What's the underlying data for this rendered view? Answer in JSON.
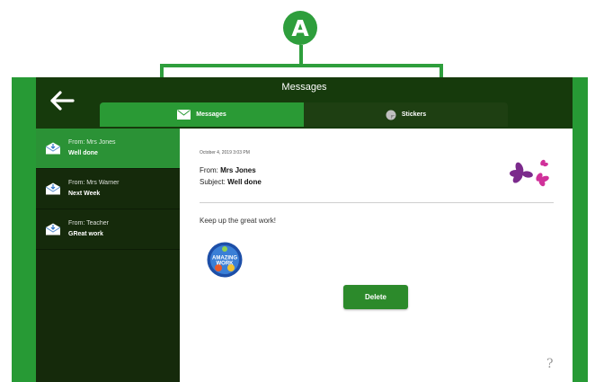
{
  "annotation": {
    "label": "A"
  },
  "header": {
    "title": "Messages"
  },
  "tabs": [
    {
      "label": "Messages",
      "icon": "envelope-icon",
      "selected": true
    },
    {
      "label": "Stickers",
      "icon": "sticker-icon",
      "selected": false
    }
  ],
  "messages": [
    {
      "from": "From: Mrs Jones",
      "subject": "Well done",
      "selected": true
    },
    {
      "from": "From: Mrs Warner",
      "subject": "Next Week",
      "selected": false
    },
    {
      "from": "From: Teacher",
      "subject": "GReat work",
      "selected": false
    }
  ],
  "detail": {
    "date": "October 4, 2019 3:03 PM",
    "from_label": "From:",
    "from_value": "Mrs Jones",
    "subject_label": "Subject:",
    "subject_value": "Well done",
    "body": "Keep up the great work!",
    "sticker_text": "AMAZING WORK",
    "delete_label": "Delete",
    "help_glyph": "?"
  },
  "colors": {
    "accent_green": "#2e9e3c",
    "header_dark": "#163a0c",
    "sidebar_dark": "#152a0b",
    "logo_purple": "#7b2a8c",
    "logo_pink": "#d0319a"
  }
}
